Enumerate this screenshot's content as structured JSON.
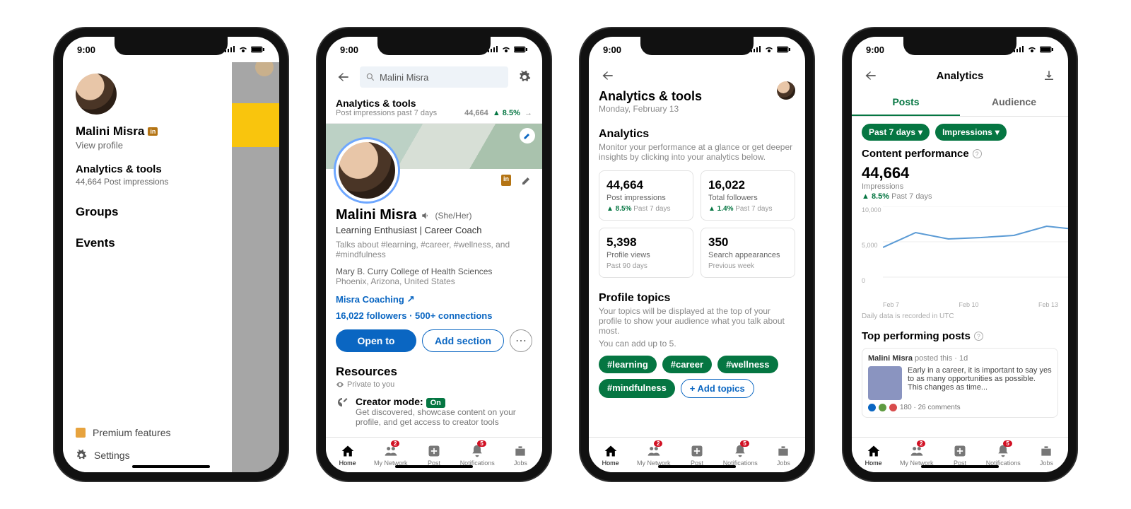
{
  "status_time": "9:00",
  "phone1": {
    "name": "Malini Misra",
    "view_profile": "View profile",
    "analytics_h": "Analytics & tools",
    "analytics_s": "44,664 Post impressions",
    "menu1": "Groups",
    "menu2": "Events",
    "premium": "Premium features",
    "settings": "Settings"
  },
  "phone2": {
    "search_placeholder": "Malini Misra",
    "atools": "Analytics & tools",
    "atools_sub": "Post impressions past 7 days",
    "atools_val": "44,664",
    "atools_delta": "▲ 8.5%",
    "name": "Malini Misra",
    "pronouns": "(She/Her)",
    "tagline": "Learning Enthusiast | Career Coach",
    "talks": "Talks about #learning, #career, #wellness, and #mindfulness",
    "edu": "Mary B. Curry College of Health Sciences",
    "loc": "Phoenix, Arizona, United States",
    "link": "Misra Coaching",
    "followers": "16,022 followers",
    "connections": "500+ connections",
    "open_to": "Open to",
    "add_section": "Add section",
    "resources": "Resources",
    "private": "Private to you",
    "creator_label": "Creator mode:",
    "creator_state": "On",
    "creator_sub": "Get discovered, showcase content on your profile, and get access to creator tools"
  },
  "phone3": {
    "title": "Analytics & tools",
    "date": "Monday, February 13",
    "section1_h": "Analytics",
    "section1_s": "Monitor your performance at a glance or get deeper insights by clicking into your analytics below.",
    "cards": [
      {
        "num": "44,664",
        "lab": "Post impressions",
        "delta": "▲ 8.5%",
        "foot": "Past 7 days"
      },
      {
        "num": "16,022",
        "lab": "Total followers",
        "delta": "▲ 1.4%",
        "foot": "Past 7 days"
      },
      {
        "num": "5,398",
        "lab": "Profile views",
        "delta": "",
        "foot": "Past 90 days"
      },
      {
        "num": "350",
        "lab": "Search appearances",
        "delta": "",
        "foot": "Previous week"
      }
    ],
    "pt_h": "Profile topics",
    "pt_s": "Your topics will be displayed at the top of your profile to show your audience what you talk about most.",
    "pt_note": "You can add up to 5.",
    "topics": [
      "#learning",
      "#career",
      "#wellness",
      "#mindfulness"
    ],
    "add_topics": "+ Add topics"
  },
  "phone4": {
    "title": "Analytics",
    "tabs": [
      "Posts",
      "Audience"
    ],
    "filter1": "Past 7 days",
    "filter2": "Impressions",
    "cp": "Content performance",
    "cp_num": "44,664",
    "cp_lab": "Impressions",
    "cp_delta": "▲ 8.5%",
    "cp_delta_lab": "Past 7 days",
    "y_ticks": [
      "10,000",
      "5,000",
      "0"
    ],
    "x_ticks": [
      "Feb 7",
      "Feb 10",
      "Feb 13"
    ],
    "utc": "Daily data is recorded in UTC",
    "tp": "Top performing posts",
    "post_author": "Malini Misra",
    "post_meta": "posted this · 1d",
    "post_text": "Early in a career, it is important to say yes to as many opportunities as possible. This changes as time...",
    "reactions": "180 · 26 comments"
  },
  "nav": {
    "home": "Home",
    "network": "My Network",
    "post": "Post",
    "notif": "Notifications",
    "jobs": "Jobs",
    "badge_network": "2",
    "badge_notif": "5"
  },
  "chart_data": {
    "type": "line",
    "title": "Content performance — Impressions",
    "xlabel": "",
    "ylabel": "Impressions",
    "ylim": [
      0,
      10000
    ],
    "x": [
      "Feb 7",
      "Feb 8",
      "Feb 9",
      "Feb 10",
      "Feb 11",
      "Feb 12",
      "Feb 13"
    ],
    "values": [
      4200,
      6300,
      5400,
      5600,
      5900,
      7200,
      6700
    ]
  }
}
